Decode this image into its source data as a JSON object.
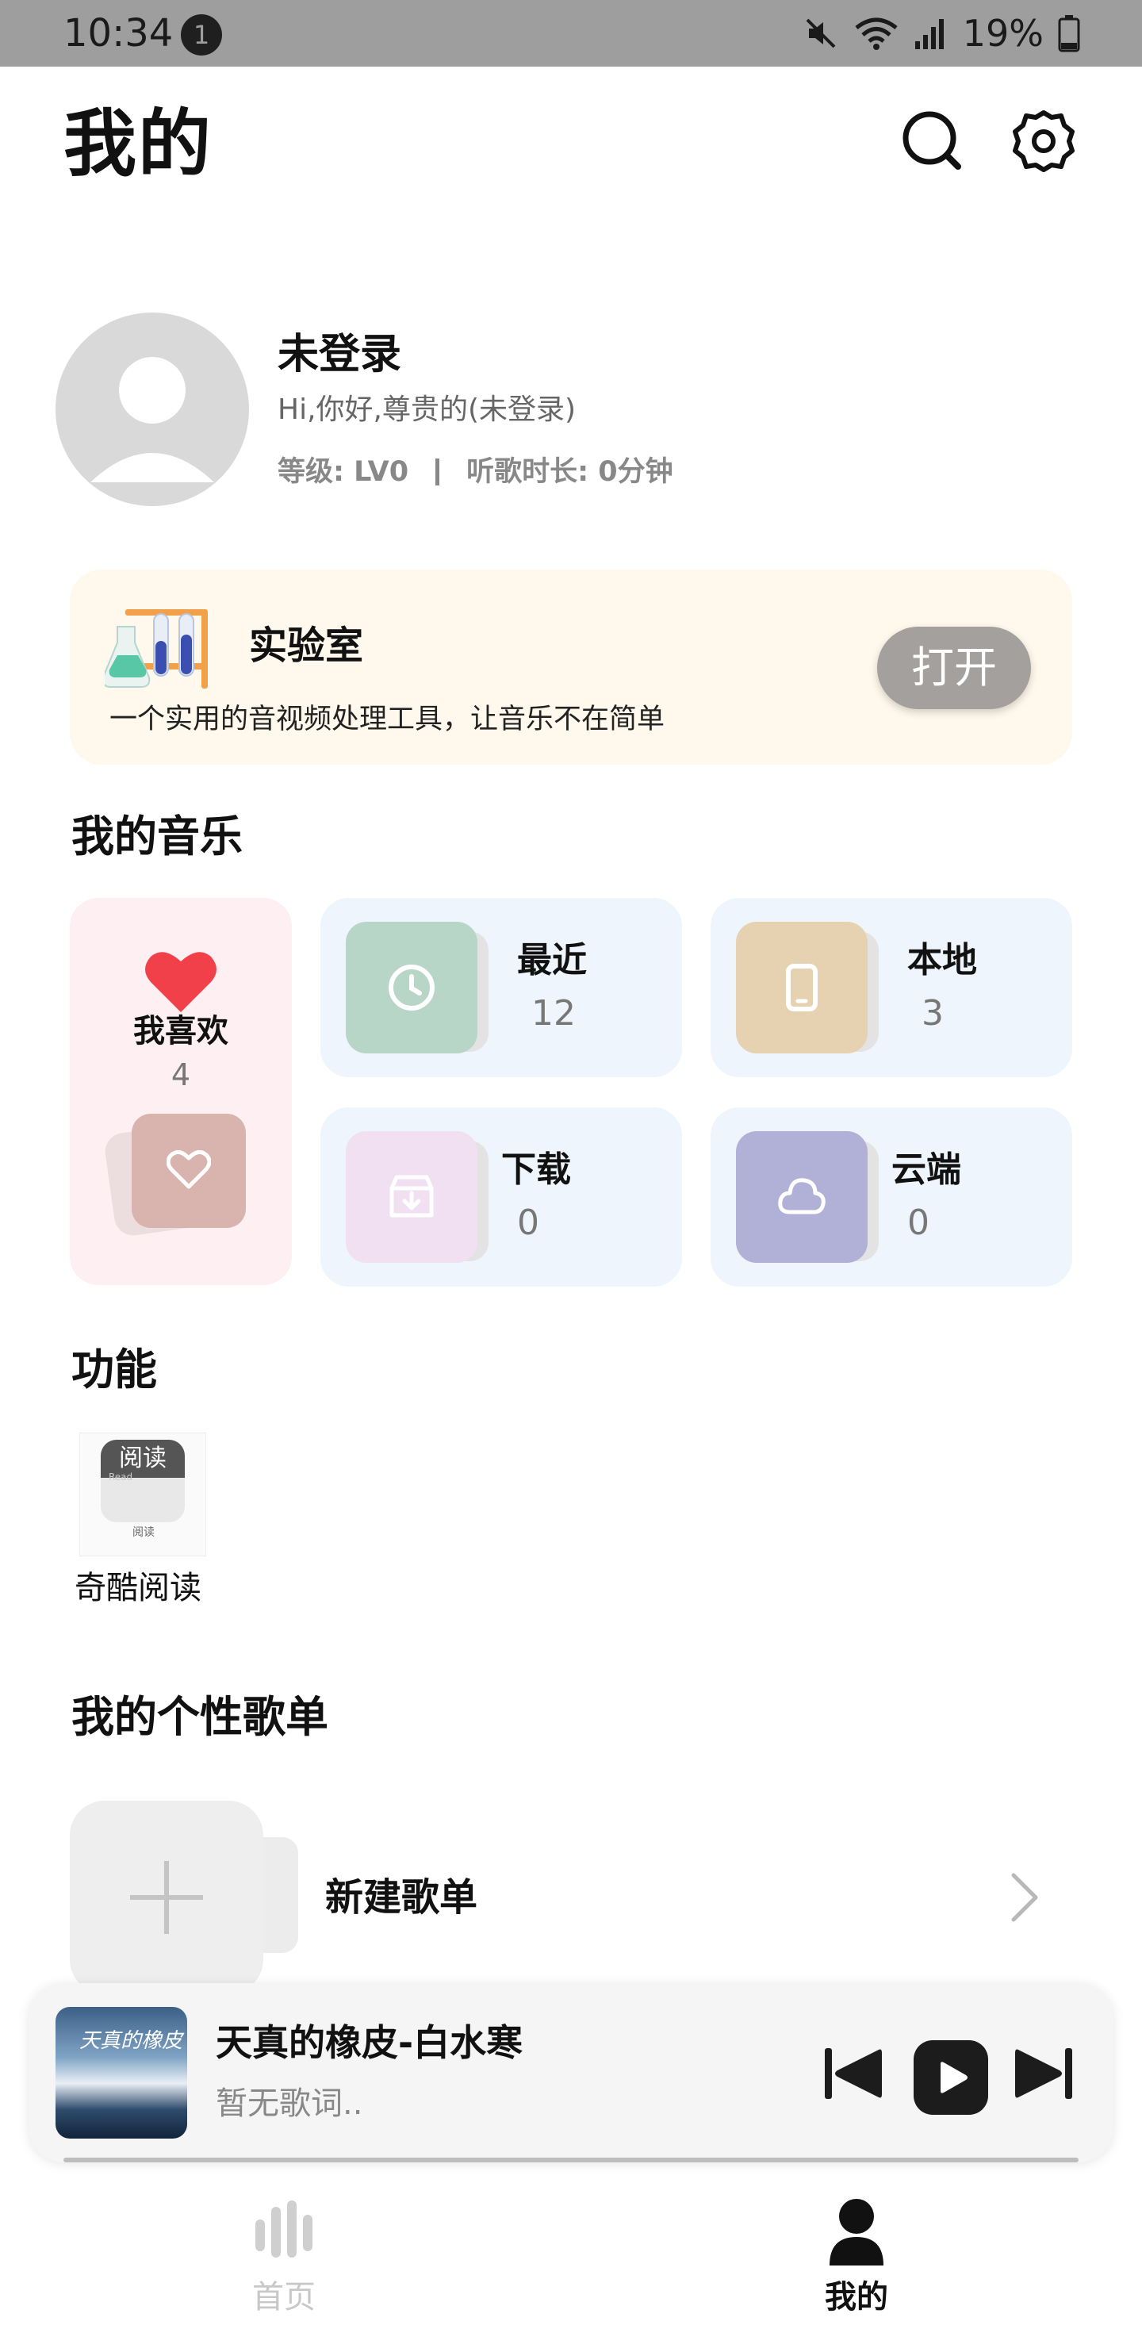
{
  "status_bar": {
    "time": "10:34",
    "notification_count": "1",
    "battery": "19%"
  },
  "header": {
    "title": "我的"
  },
  "profile": {
    "name": "未登录",
    "greeting": "Hi,你好,尊贵的(未登录)",
    "level": "等级: LV0",
    "listen_time": "听歌时长: 0分钟"
  },
  "lab": {
    "title": "实验室",
    "description": "一个实用的音视频处理工具，让音乐不在简单",
    "button": "打开"
  },
  "my_music": {
    "title": "我的音乐",
    "favorites": {
      "label": "我喜欢",
      "count": "4"
    },
    "recent": {
      "label": "最近",
      "count": "12"
    },
    "local": {
      "label": "本地",
      "count": "3"
    },
    "download": {
      "label": "下载",
      "count": "0"
    },
    "cloud": {
      "label": "云端",
      "count": "0"
    }
  },
  "features": {
    "title": "功能",
    "items": [
      {
        "icon_text": "阅读",
        "icon_sub": "Read",
        "icon_caption": "阅读",
        "label": "奇酷阅读"
      }
    ]
  },
  "playlists": {
    "title": "我的个性歌单",
    "new_label": "新建歌单"
  },
  "player": {
    "title": "天真的橡皮-白水寒",
    "subtitle": "暂无歌词..",
    "art_text": "天真的橡皮"
  },
  "bottom_nav": {
    "home": "首页",
    "mine": "我的"
  },
  "colors": {
    "fav_tile": "#fef0f2",
    "tile_bg": "#eef5fc",
    "lab_bg": "#fff8ec",
    "heart": "#f2404b",
    "recent_cover": "#b7d6c7",
    "local_cover": "#e6d2b0",
    "download_cover": "#f1dff2",
    "cloud_cover": "#b1b1d8"
  }
}
